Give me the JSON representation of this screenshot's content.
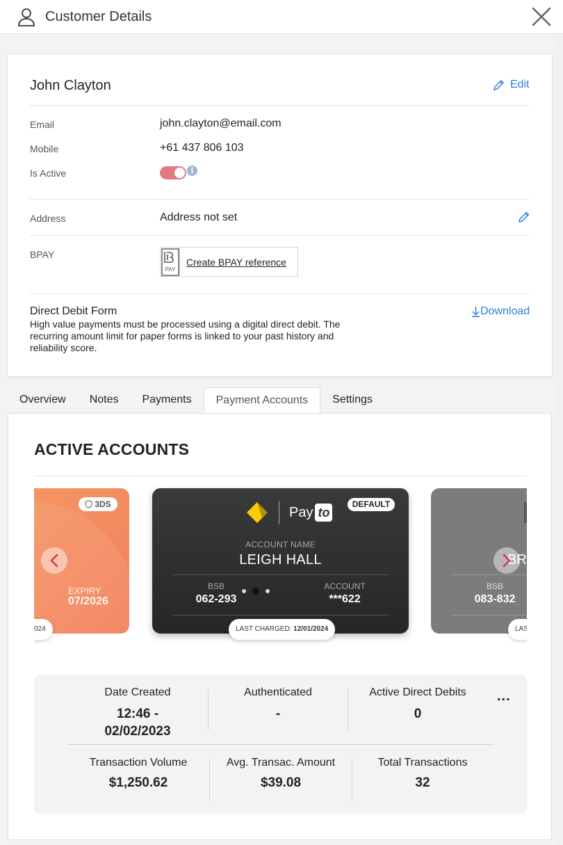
{
  "header": {
    "title": "Customer Details"
  },
  "customer": {
    "name": "John Clayton",
    "edit_label": "Edit",
    "fields": {
      "email_label": "Email",
      "email": "john.clayton@email.com",
      "mobile_label": "Mobile",
      "mobile": "+61 437 806 103",
      "active_label": "Is Active",
      "active": true,
      "address_label": "Address",
      "address": "Address not set",
      "bpay_label": "BPAY",
      "bpay_logo_text": "PAY",
      "bpay_link": "Create BPAY reference"
    },
    "direct_debit": {
      "title": "Direct Debit Form",
      "description": "High value payments must be processed using a digital direct debit. The recurring amount limit for paper forms is linked to your past history and reliability score.",
      "download_label": "Download"
    }
  },
  "tabs": [
    {
      "label": "Overview",
      "active": false
    },
    {
      "label": "Notes",
      "active": false
    },
    {
      "label": "Payments",
      "active": false
    },
    {
      "label": "Payment Accounts",
      "active": true
    },
    {
      "label": "Settings",
      "active": false
    }
  ],
  "accounts": {
    "section_title": "ACTIVE ACCOUNTS",
    "cards": [
      {
        "style": "orange",
        "badge": "3DS",
        "expiry_label": "EXPIRY",
        "expiry": "07/2026",
        "last_charged_partial": "024"
      },
      {
        "style": "dark",
        "badge": "DEFAULT",
        "logo_text": "Pay",
        "logo_to": "to",
        "name_label": "ACCOUNT NAME",
        "name": "LEIGH HALL",
        "bsb_label": "BSB",
        "bsb": "062-293",
        "account_label": "ACCOUNT",
        "account": "***622",
        "last_charged_label": "LAST CHARGED:",
        "last_charged": "12/01/2024"
      },
      {
        "style": "grey",
        "name_partial": "BR",
        "bsb_label": "BSB",
        "bsb": "083-832",
        "last_charged_partial": "LAS"
      }
    ],
    "active_index": 1,
    "page_count": 3
  },
  "stats": {
    "more_label": "...",
    "row1": [
      {
        "label": "Date Created",
        "value": "12:46 -\n02/02/2023"
      },
      {
        "label": "Authenticated",
        "value": "-"
      },
      {
        "label": "Active Direct Debits",
        "value": "0"
      }
    ],
    "row2": [
      {
        "label": "Transaction Volume",
        "value": "$1,250.62"
      },
      {
        "label": "Avg. Transac. Amount",
        "value": "$39.08"
      },
      {
        "label": "Total Transactions",
        "value": "32"
      }
    ]
  },
  "colors": {
    "accent": "#2e7dd7",
    "toggle_on": "#e07b86",
    "arrow": "#d9334b"
  }
}
